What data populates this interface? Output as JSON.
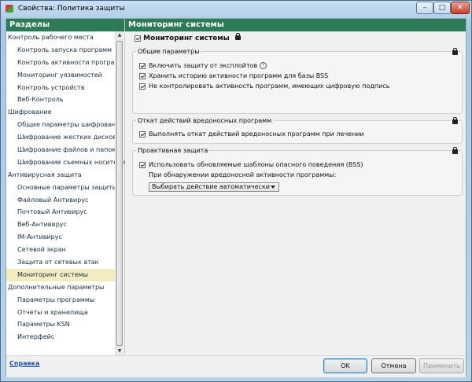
{
  "window": {
    "title": "Свойства: Политика защиты",
    "controls": [
      "–",
      "□",
      "✕"
    ]
  },
  "sidebar": {
    "header": "Разделы",
    "items": [
      {
        "label": "Контроль рабочего места",
        "level": 0
      },
      {
        "label": "Контроль запуска программ",
        "level": 1
      },
      {
        "label": "Контроль активности программ",
        "level": 1
      },
      {
        "label": "Мониторинг уязвимостей",
        "level": 1
      },
      {
        "label": "Контроль устройств",
        "level": 1
      },
      {
        "label": "Веб-Контроль",
        "level": 1
      },
      {
        "label": "Шифрование",
        "level": 0
      },
      {
        "label": "Общие параметры шифрования",
        "level": 1
      },
      {
        "label": "Шифрование жестких дисков",
        "level": 1
      },
      {
        "label": "Шифрование файлов и папок",
        "level": 1
      },
      {
        "label": "Шифрование съемных носителей",
        "level": 1
      },
      {
        "label": "Антивирусная защита",
        "level": 0
      },
      {
        "label": "Основные параметры защиты",
        "level": 1
      },
      {
        "label": "Файловый Антивирус",
        "level": 1
      },
      {
        "label": "Почтовый Антивирус",
        "level": 1
      },
      {
        "label": "Веб-Антивирус",
        "level": 1
      },
      {
        "label": "IM-Антивирус",
        "level": 1
      },
      {
        "label": "Сетевой экран",
        "level": 1
      },
      {
        "label": "Защита от сетевых атак",
        "level": 1
      },
      {
        "label": "Мониторинг системы",
        "level": 1,
        "selected": true
      },
      {
        "label": "Дополнительные параметры",
        "level": 0
      },
      {
        "label": "Параметры программы",
        "level": 1
      },
      {
        "label": "Отчеты и хранилища",
        "level": 1
      },
      {
        "label": "Параметры KSN",
        "level": 1
      },
      {
        "label": "Интерфейс",
        "level": 1
      }
    ]
  },
  "main": {
    "header": "Мониторинг системы",
    "enable_label": "Мониторинг системы",
    "groups": {
      "general": {
        "title": "Общие параметры",
        "options": [
          "Включить защиту от эксплойтов",
          "Хранить историю активности программ для базы BSS",
          "Не контролировать активность программ, имеющих цифровую подпись"
        ]
      },
      "rollback": {
        "title": "Откат действий вредоносных программ",
        "options": [
          "Выполнять откат действий вредоносных программ при лечении"
        ]
      },
      "proactive": {
        "title": "Проактивная защита",
        "option": "Использовать обновляемые шаблоны опасного поведения (BSS)",
        "detect_label": "При обнаружении вредоносной активности программы:",
        "action_value": "Выбирать действие автоматически"
      }
    }
  },
  "footer": {
    "help": "Справка",
    "ok": "OK",
    "cancel": "Отмена",
    "apply": "Применить"
  },
  "colors": {
    "header_green": "#2d7a56",
    "selected_bg": "#f3ecc0",
    "link": "#1f4fb0"
  }
}
